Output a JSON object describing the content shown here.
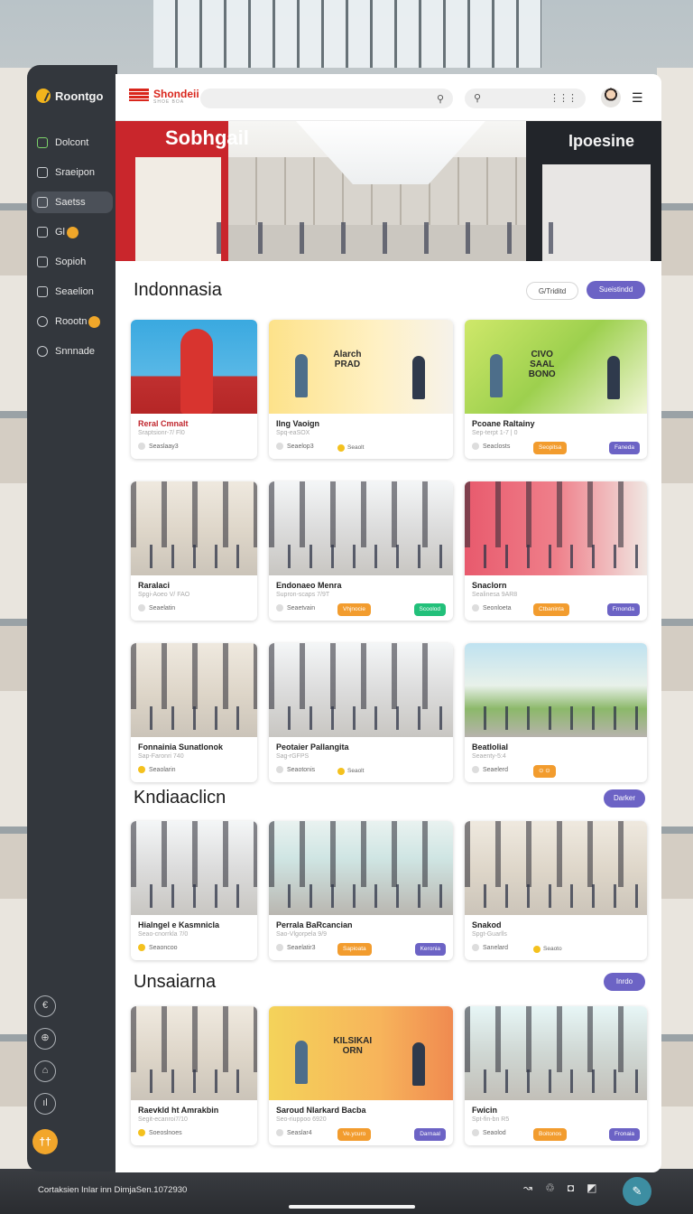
{
  "sidebar": {
    "brand": "Roontgo",
    "items": [
      {
        "label": "Dolcont",
        "icon": "square-icon",
        "active": false
      },
      {
        "label": "Sraeipon",
        "icon": "home-icon",
        "active": false
      },
      {
        "label": "Saetss",
        "icon": "grid-icon",
        "active": true
      },
      {
        "label": "Gl",
        "icon": "square-icon",
        "badge": "",
        "active": false
      },
      {
        "label": "Sopioh",
        "icon": "home-icon",
        "active": false
      },
      {
        "label": "Seaelion",
        "icon": "square-icon",
        "active": false
      },
      {
        "label": "Roootn",
        "icon": "clock-icon",
        "badge": "",
        "active": false
      },
      {
        "label": "Snnnade",
        "icon": "gear-icon",
        "active": false
      }
    ],
    "tools": [
      "€",
      "⊕",
      "⌂",
      "ıl"
    ],
    "fab": "††"
  },
  "header": {
    "logo_text": "Shondeii",
    "logo_sub": "SHOE BOA"
  },
  "hero": {
    "left_sign": "Sobhgail",
    "right_sign": "Ipoesine"
  },
  "sections": [
    {
      "title": "Indonnasia",
      "button_outline": "G/Triditd",
      "button": "Sueistindd"
    },
    {
      "title": "Kndiaaclicn",
      "button": "Darker"
    },
    {
      "title": "Unsaiarna",
      "button": "Inrdo"
    }
  ],
  "cards": [
    {
      "name": "Reral Cmnalt",
      "sub": "Sraptsionr-7/ Fl0",
      "foot": "Seaslaay3",
      "tag": "",
      "tag_color": "",
      "chip": "",
      "img": "img-red",
      "red": true
    },
    {
      "name": "Ilng Vaoign",
      "sub": "Spq-eaSOX",
      "foot": "Seaelop3",
      "tag": "",
      "tag_color": "",
      "chip": "Seaolt",
      "img": "img-yellow",
      "sign": "Alarch\nPRAD"
    },
    {
      "name": "Pcoane Raltainy",
      "sub": "Sep-terpt 1-7 | 0",
      "foot": "Seaclosts",
      "tag": "Seopitsa",
      "tag_color": "orange",
      "tag2": "Faneda",
      "img": "img-green",
      "sign": "CIVO\nSAAL\nBONO"
    },
    {
      "name": "Raralaci",
      "sub": "Spgi-Aoeo V/ FAO",
      "foot": "Seaelatin",
      "tag": "",
      "tag_color": "",
      "img": "img-store"
    },
    {
      "name": "Endonaeo Menra",
      "sub": "Supron-scaps 7/9T",
      "foot": "Seaetvain",
      "tag": "Vhjnocie",
      "tag_color": "orange",
      "tag2": "Scoolod",
      "tag2_color": "green",
      "img": "img-hall"
    },
    {
      "name": "Snaclorn",
      "sub": "Sealinesa 9AR8",
      "foot": "Seonloeta",
      "tag": "Ctbaninta",
      "tag_color": "orange",
      "tag2": "Frnonda",
      "img": "img-pink"
    },
    {
      "name": "Fonnainia Sunatlonok",
      "sub": "Sap-Faronri 740",
      "foot": "Seaolarin",
      "tag": "",
      "tag_color": "",
      "img": "img-store"
    },
    {
      "name": "Peotaier Pallangita",
      "sub": "Sag-rGFPS",
      "foot": "Seaotonis",
      "tag": "",
      "tag_color": "",
      "chip": "Seaolt",
      "img": "img-hall"
    },
    {
      "name": "Beatlolial",
      "sub": "Seaenty-5:4",
      "foot": "Seaelerd",
      "tag": "⊙ ⊙",
      "tag_color": "orange",
      "img": "img-outdoor"
    },
    {
      "name": "Hialngel e Kasmnicla",
      "sub": "Seao-cnorrkla 7/0",
      "foot": "Seaoncoo",
      "tag": "",
      "tag_color": "",
      "img": "img-hall"
    },
    {
      "name": "Perrala BaRcancian",
      "sub": "Sao-Vlgorpela 9/9",
      "foot": "Seaelatir3",
      "tag": "Sapioata",
      "tag_color": "orange",
      "tag2": "Keronia",
      "img": "img-teal"
    },
    {
      "name": "Snakod",
      "sub": "Spgt-Guarlls",
      "foot": "Sanelard",
      "tag": "",
      "tag_color": "",
      "chip": "Seaoto",
      "img": "img-store"
    },
    {
      "name": "Raevkld ht Amrakbin",
      "sub": "Segit-ecanroi7/10",
      "foot": "Soeoslnoes",
      "tag": "",
      "tag_color": "",
      "img": "img-store"
    },
    {
      "name": "Saroud Nlarkard Bacba",
      "sub": "Seo-riuppoo 6920",
      "foot": "Seaslar4",
      "tag": "Ve.ycuro",
      "tag_color": "orange",
      "tag2": "Darnaal",
      "img": "img-orange",
      "sign": "KILSIKAI\nORN"
    },
    {
      "name": "Fwicin",
      "sub": "Spt-fin-bn R5",
      "foot": "Seaolod",
      "tag": "Boitonos",
      "tag_color": "orange",
      "tag2": "Fronaia",
      "img": "img-lime"
    }
  ],
  "bottom": {
    "status": "Cortaksien Inlar inn DimjaSen.1072930",
    "icons": [
      "↝",
      "♲",
      "◘",
      "◩"
    ],
    "fab": "✎"
  }
}
